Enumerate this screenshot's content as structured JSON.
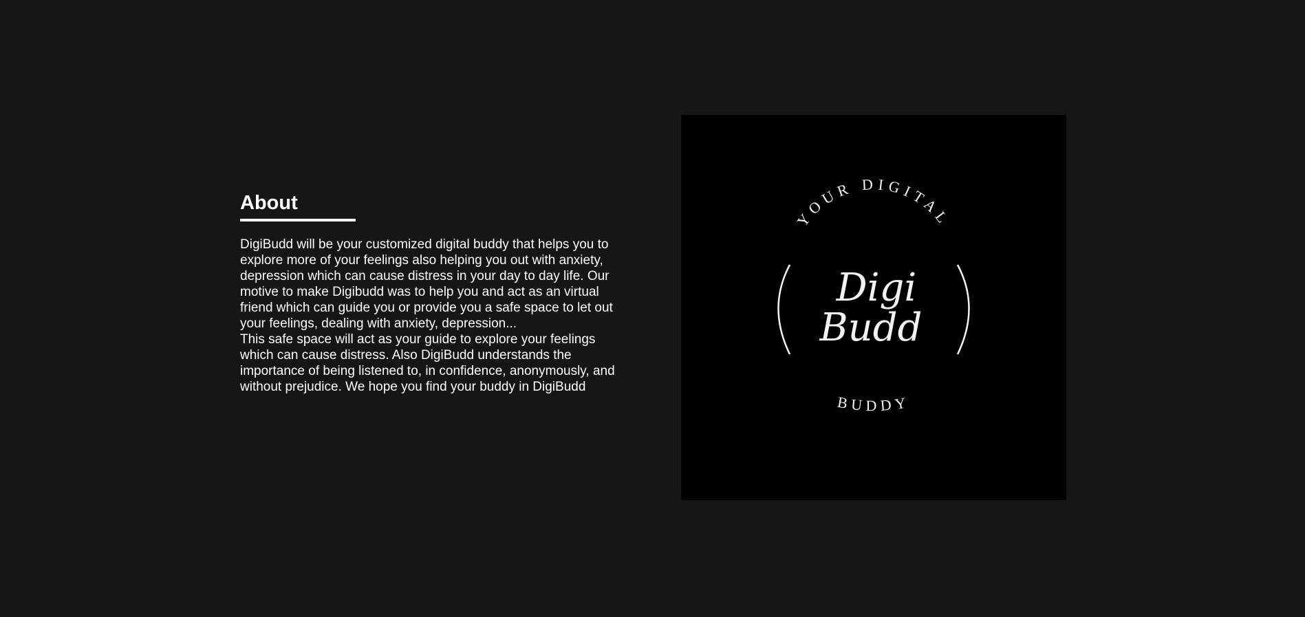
{
  "about": {
    "heading": "About",
    "paragraphs": [
      "DigiBudd will be your customized digital buddy that helps you to explore more of your feelings also helping you out with anxiety, depression which can cause distress in your day to day life. Our motive to make Digibudd was to help you and act as an virtual friend which can guide you or provide you a safe space to let out your feelings, dealing with anxiety, depression...",
      "This safe space will act as your guide to explore your feelings which can cause distress. Also DigiBudd understands the importance of being listened to, in confidence, anonymously, and without prejudice. We hope you find your buddy in DigiBudd"
    ]
  },
  "logo": {
    "top_arc_text": "YOUR DIGITAL",
    "script_line_1": "Digi",
    "script_line_2": "Budd",
    "bottom_arc_text": "BUDDY",
    "background_color": "#000000",
    "foreground_color": "#f2f2f2"
  },
  "colors": {
    "page_background": "#161616",
    "text": "#ffffff"
  }
}
